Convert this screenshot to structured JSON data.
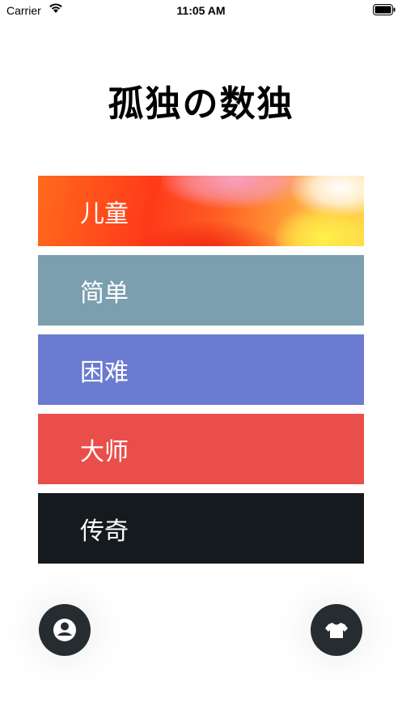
{
  "status_bar": {
    "carrier": "Carrier",
    "time": "11:05 AM",
    "wifi_icon": "wifi-icon",
    "battery_icon": "battery-icon"
  },
  "title": "孤独の数独",
  "levels": [
    {
      "label": "儿童",
      "color": "#ff4a1c"
    },
    {
      "label": "简单",
      "color": "#7b9fae"
    },
    {
      "label": "困难",
      "color": "#6a7bd1"
    },
    {
      "label": "大师",
      "color": "#e94e4b"
    },
    {
      "label": "传奇",
      "color": "#141a1d"
    }
  ],
  "buttons": {
    "profile_icon": "user-icon",
    "skin_icon": "tshirt-icon",
    "button_color": "#252d31"
  }
}
